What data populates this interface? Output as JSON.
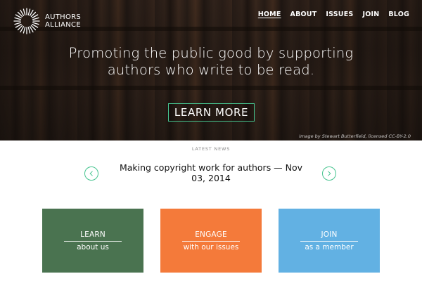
{
  "brand": {
    "line1": "AUTHORS",
    "line2": "ALLIANCE"
  },
  "nav": {
    "items": [
      {
        "label": "HOME",
        "active": true
      },
      {
        "label": "ABOUT",
        "active": false
      },
      {
        "label": "ISSUES",
        "active": false
      },
      {
        "label": "JOIN",
        "active": false
      },
      {
        "label": "BLOG",
        "active": false
      }
    ]
  },
  "hero": {
    "headline": "Promoting the public good by supporting authors who write to be read.",
    "cta_label": "LEARN MORE",
    "credit": "Image by Stewart Butterfield, licensed CC-BY-2.0"
  },
  "news": {
    "section_label": "LATEST NEWS",
    "title": "Making copyright work for authors — Nov 03, 2014",
    "prev_icon": "chevron-left-icon",
    "next_icon": "chevron-right-icon"
  },
  "tiles": [
    {
      "title": "LEARN",
      "subtitle": "about us",
      "color": "#4a7350"
    },
    {
      "title": "ENGAGE",
      "subtitle": "with our issues",
      "color": "#f47a3a"
    },
    {
      "title": "JOIN",
      "subtitle": "as a member",
      "color": "#62b1e3"
    }
  ],
  "colors": {
    "accent": "#46c48f"
  }
}
